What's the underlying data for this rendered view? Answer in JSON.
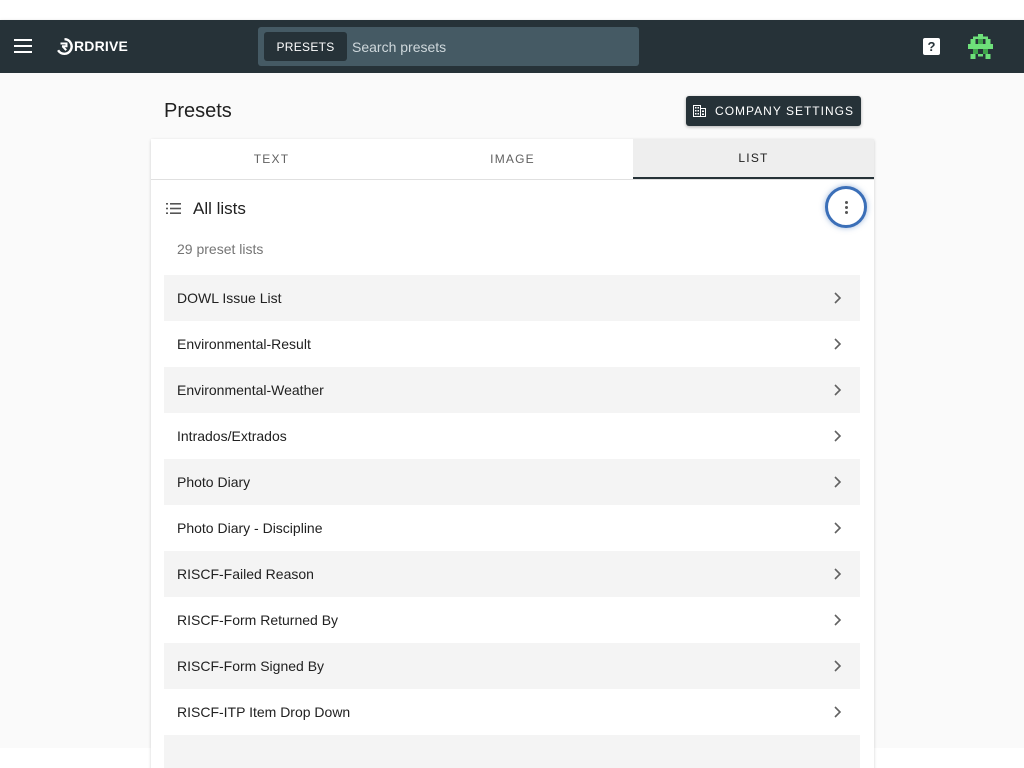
{
  "app": {
    "logo_text": "RDRIVE",
    "menu_icon": "hamburger-menu-icon",
    "logo_icon": "rdrive-logo-icon",
    "help_icon": "help-icon",
    "avatar_icon": "pixel-avatar-icon"
  },
  "search": {
    "chip_label": "PRESETS",
    "placeholder": "Search presets",
    "value": ""
  },
  "page": {
    "title": "Presets",
    "company_settings_label": "COMPANY SETTINGS"
  },
  "tabs": [
    {
      "label": "TEXT",
      "active": false
    },
    {
      "label": "IMAGE",
      "active": false
    },
    {
      "label": "LIST",
      "active": true
    }
  ],
  "list": {
    "title": "All lists",
    "count_text": "29 preset lists",
    "items": [
      {
        "label": "DOWL Issue List"
      },
      {
        "label": "Environmental-Result"
      },
      {
        "label": "Environmental-Weather"
      },
      {
        "label": "Intrados/Extrados"
      },
      {
        "label": "Photo Diary"
      },
      {
        "label": "Photo Diary - Discipline"
      },
      {
        "label": "RISCF-Failed Reason"
      },
      {
        "label": "RISCF-Form Returned By"
      },
      {
        "label": "RISCF-Form Signed By"
      },
      {
        "label": "RISCF-ITP Item Drop Down"
      },
      {
        "label": ""
      }
    ]
  },
  "colors": {
    "topbar": "#263238",
    "accent_focus": "#3b6fb8",
    "avatar_green": "#6ee07a"
  }
}
